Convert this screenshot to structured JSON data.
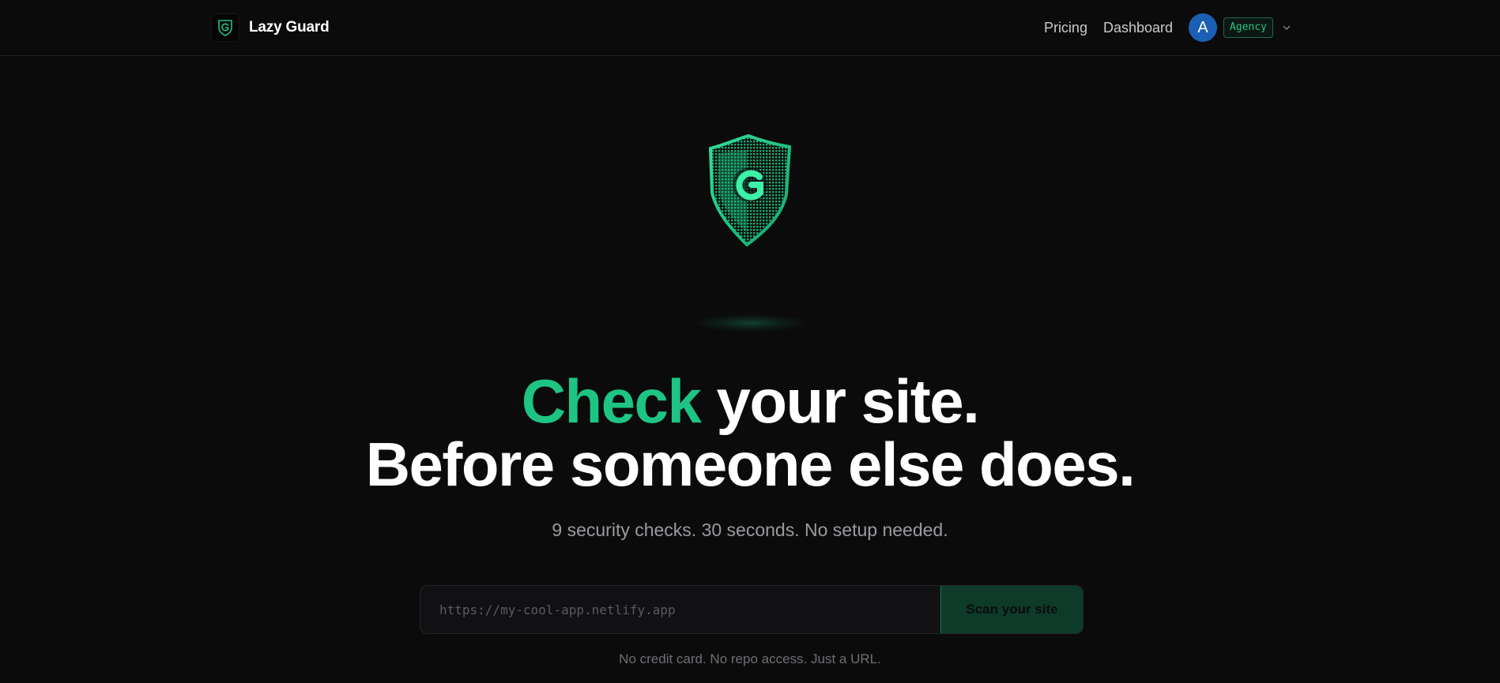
{
  "header": {
    "brand_name": "Lazy Guard",
    "nav": {
      "pricing": "Pricing",
      "dashboard": "Dashboard"
    },
    "user": {
      "avatar_initial": "A",
      "plan_badge": "Agency"
    }
  },
  "hero": {
    "headline_accent": "Check",
    "headline_rest": " your site.",
    "headline_line2": "Before someone else does.",
    "subhead": "9 security checks. 30 seconds. No setup needed."
  },
  "scan": {
    "url_placeholder": "https://my-cool-app.netlify.app",
    "url_value": "",
    "button_label": "Scan your site",
    "fineprint": "No credit card. No repo access. Just a URL."
  },
  "colors": {
    "accent": "#1ec483",
    "background": "#0b0b0c",
    "avatar": "#1a5fb4",
    "button": "#0e3b29"
  }
}
